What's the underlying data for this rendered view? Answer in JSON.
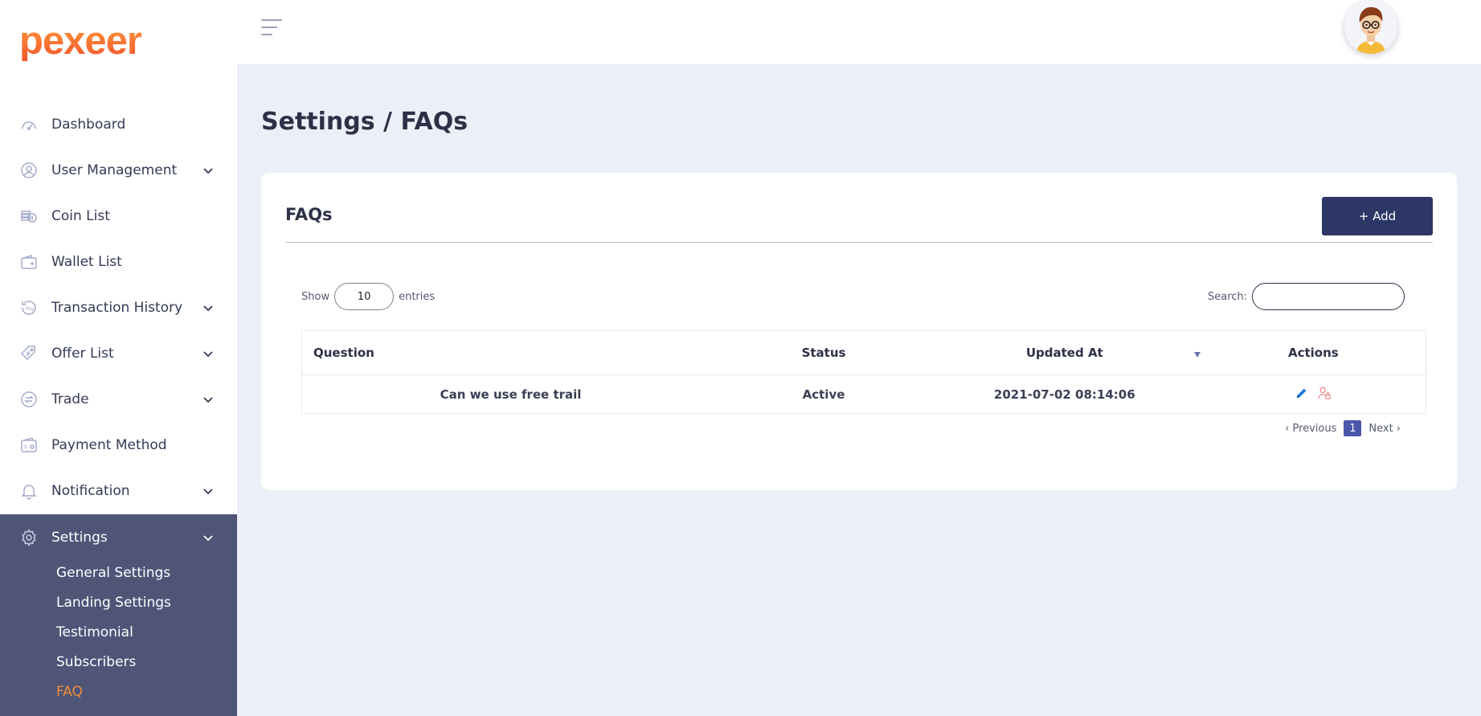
{
  "brand": {
    "logo_text": "pexeer",
    "colors": {
      "accent": "#f28c38",
      "primary": "#2d3766",
      "sidebar_active_bg": "#4e5577"
    }
  },
  "sidebar": {
    "items": [
      {
        "label": "Dashboard",
        "icon": "speedometer-icon",
        "has_submenu": false
      },
      {
        "label": "User Management",
        "icon": "user-circle-icon",
        "has_submenu": true
      },
      {
        "label": "Coin List",
        "icon": "coins-icon",
        "has_submenu": false
      },
      {
        "label": "Wallet List",
        "icon": "wallet-icon",
        "has_submenu": false
      },
      {
        "label": "Transaction History",
        "icon": "pay-history-icon",
        "has_submenu": true
      },
      {
        "label": "Offer List",
        "icon": "offer-tag-icon",
        "has_submenu": true
      },
      {
        "label": "Trade",
        "icon": "exchange-icon",
        "has_submenu": true
      },
      {
        "label": "Payment Method",
        "icon": "payment-card-icon",
        "has_submenu": false
      },
      {
        "label": "Notification",
        "icon": "bell-icon",
        "has_submenu": true
      }
    ],
    "settings": {
      "label": "Settings",
      "icon": "gear-icon",
      "expanded": true,
      "subitems": [
        {
          "label": "General Settings",
          "active": false
        },
        {
          "label": "Landing Settings",
          "active": false
        },
        {
          "label": "Testimonial",
          "active": false
        },
        {
          "label": "Subscribers",
          "active": false
        },
        {
          "label": "FAQ",
          "active": true
        }
      ]
    }
  },
  "topbar": {
    "menu_icon": "hamburger-icon",
    "avatar_icon": "user-avatar-icon"
  },
  "main": {
    "breadcrumb": "Settings  /  FAQs",
    "card": {
      "title": "FAQs",
      "add_label": "+ Add",
      "length": {
        "prefix": "Show",
        "value": "10",
        "suffix": "entries"
      },
      "search": {
        "label": "Search:",
        "value": ""
      },
      "table": {
        "columns": [
          "Question",
          "Status",
          "Updated At",
          "Actions"
        ],
        "sorted_column": "Updated At",
        "rows": [
          {
            "question": "Can we use free trail",
            "status": "Active",
            "updated_at": "2021-07-02 08:14:06",
            "actions": [
              "edit-pencil-icon",
              "user-lock-icon"
            ]
          }
        ]
      },
      "pagination": {
        "previous": "‹ Previous",
        "current": "1",
        "next": "Next ›"
      }
    }
  }
}
